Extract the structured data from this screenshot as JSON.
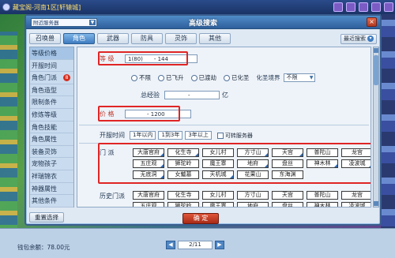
{
  "game_bar": {
    "title": "藏宝阁-河南1区[轩辕城]"
  },
  "dialog": {
    "server": "附近服务器",
    "title": "高级搜索",
    "close": "×"
  },
  "tabs": [
    {
      "label": "召唤兽"
    },
    {
      "label": "角色"
    },
    {
      "label": "武器"
    },
    {
      "label": "防具"
    },
    {
      "label": "灵饰"
    },
    {
      "label": "其他"
    }
  ],
  "recent_search": {
    "label": "最近搜索"
  },
  "sidebar": {
    "items": [
      {
        "label": "等级价格"
      },
      {
        "label": "开服时间"
      },
      {
        "label": "角色门派",
        "badge": "8"
      },
      {
        "label": "角色造型"
      },
      {
        "label": "限制条件"
      },
      {
        "label": "修炼等级"
      },
      {
        "label": "角色技能"
      },
      {
        "label": "角色属性"
      },
      {
        "label": "装备灵饰"
      },
      {
        "label": "宠物孩子"
      },
      {
        "label": "祥瑞锦衣"
      },
      {
        "label": "神器属性"
      },
      {
        "label": "其他条件"
      }
    ]
  },
  "level": {
    "label": "等  级",
    "min": "1(80)",
    "max": "- 144"
  },
  "fly": {
    "options": [
      "不限",
      "已飞升",
      "已渡劫",
      "已化圣"
    ],
    "hs_label": "化圣境界",
    "hs_value": "不限"
  },
  "exp": {
    "label": "总经验",
    "unit": "亿"
  },
  "price": {
    "label": "价  格",
    "value": "- 1200"
  },
  "open_time": {
    "label": "开服时间",
    "options": [
      "1年以内",
      "1到3年",
      "3年以上"
    ],
    "server_check": "可转服务器"
  },
  "sects": {
    "label": "门  派",
    "items": [
      "大唐官府",
      "化生寺",
      "女儿村",
      "方寸山",
      "天宫",
      "普陀山",
      "龙宫",
      "五庄观",
      "狮驼岭",
      "魔王寨",
      "地府",
      "盘丝",
      "神木林",
      "凌波城",
      "无底洞",
      "女魃墓",
      "天机城",
      "花果山",
      "东海渊",
      "",
      ""
    ],
    "checked": [
      true,
      true,
      false,
      true,
      true,
      false,
      false,
      true,
      false,
      false,
      true,
      false,
      true,
      true,
      true,
      false,
      true,
      false,
      false,
      false,
      false
    ]
  },
  "history_sects": {
    "label": "历史门派",
    "items": [
      "大唐官府",
      "化生寺",
      "女儿村",
      "方寸山",
      "天宫",
      "普陀山",
      "龙宫",
      "五庄观",
      "狮驼岭",
      "魔王寨",
      "地府",
      "盘丝",
      "神木林",
      "凌波城"
    ]
  },
  "footer": {
    "reset": "重置选择",
    "confirm": "确 定",
    "wallet": "钱包余额：78.00元",
    "page": "2/11",
    "prev": "◀",
    "next": "▶"
  }
}
